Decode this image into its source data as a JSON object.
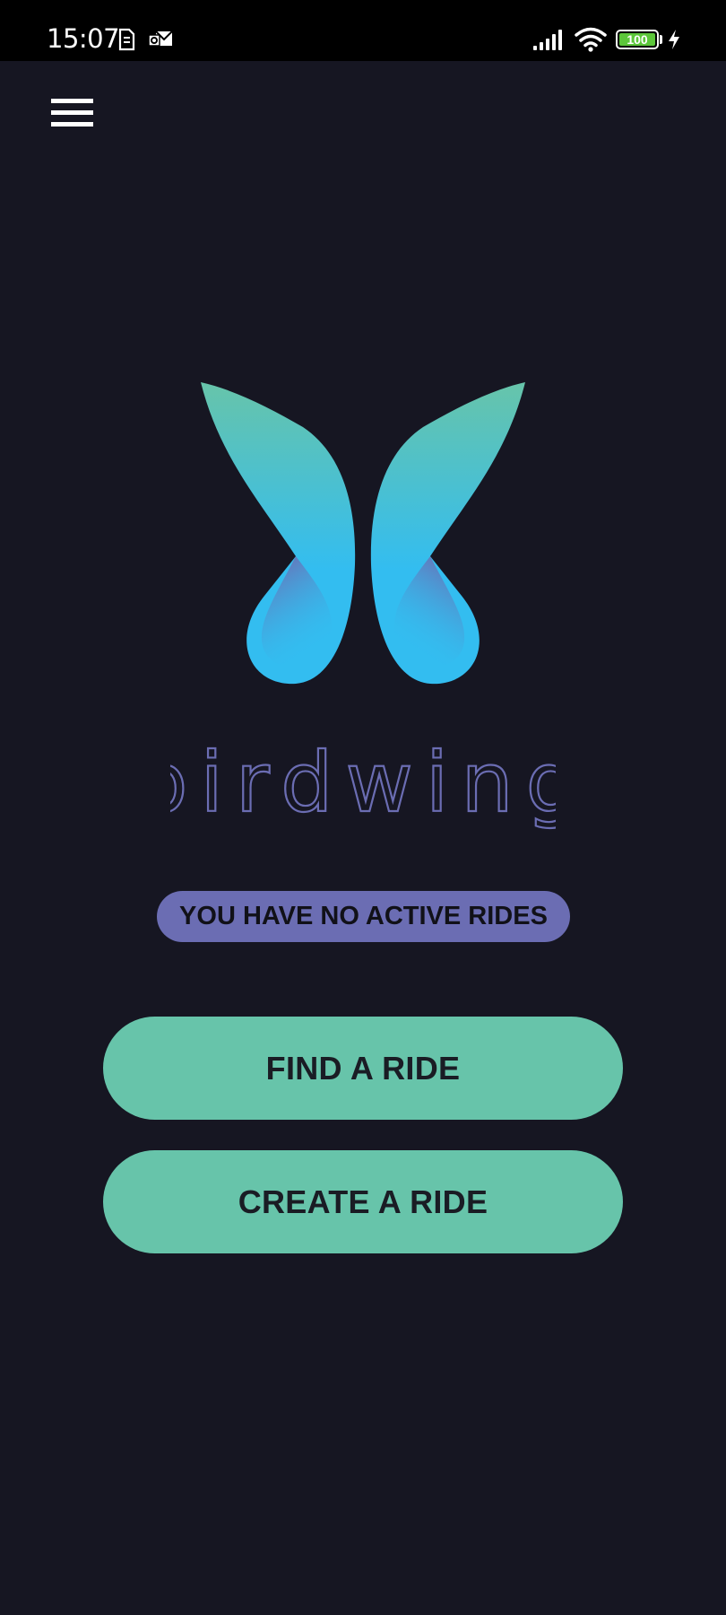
{
  "status_bar": {
    "time": "15:07",
    "battery_level": "100",
    "icons": [
      "sim-icon",
      "mail-icon",
      "signal-icon",
      "wifi-icon",
      "battery-icon",
      "charging-icon"
    ]
  },
  "header": {
    "menu_icon": "hamburger-menu-icon"
  },
  "brand": {
    "name": "birdwing",
    "logo_colors": {
      "wing_top": "#67c4aa",
      "wing_mid": "#33bdf0",
      "wing_inner": "#6b6db3"
    },
    "wordmark_color": "#6b6db3"
  },
  "main": {
    "status_text": "YOU HAVE NO ACTIVE RIDES",
    "find_ride_label": "FIND A RIDE",
    "create_ride_label": "CREATE A RIDE"
  },
  "colors": {
    "background": "#161622",
    "accent": "#67c4aa",
    "pill": "#6b6db3"
  }
}
